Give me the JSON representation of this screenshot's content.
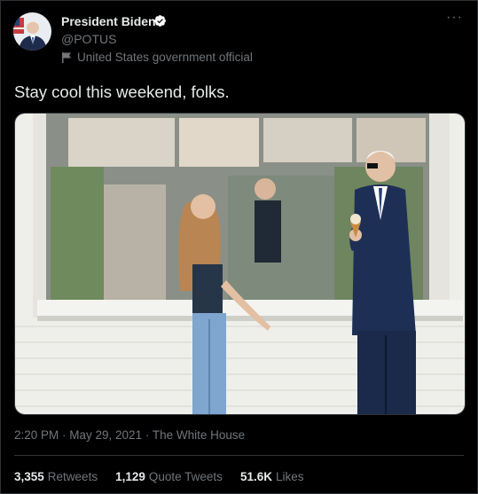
{
  "author": {
    "display_name": "President Biden",
    "handle": "@POTUS",
    "label": "United States government official"
  },
  "tweet": {
    "text": "Stay cool this weekend, folks.",
    "timestamp": "2:20 PM · May 29, 2021",
    "separator": " · ",
    "source": "The White House"
  },
  "stats": {
    "retweets_count": "3,355",
    "retweets_label": "Retweets",
    "quotes_count": "1,129",
    "quotes_label": "Quote Tweets",
    "likes_count": "51.6K",
    "likes_label": "Likes"
  },
  "menu": {
    "more_label": "···"
  },
  "icons": {
    "verified": "verified-badge-icon",
    "government": "flag-icon",
    "more": "more-options-icon"
  },
  "colors": {
    "background": "#000000",
    "text_primary": "#e7e9ea",
    "text_secondary": "#71767b",
    "divider": "#2f3336"
  }
}
